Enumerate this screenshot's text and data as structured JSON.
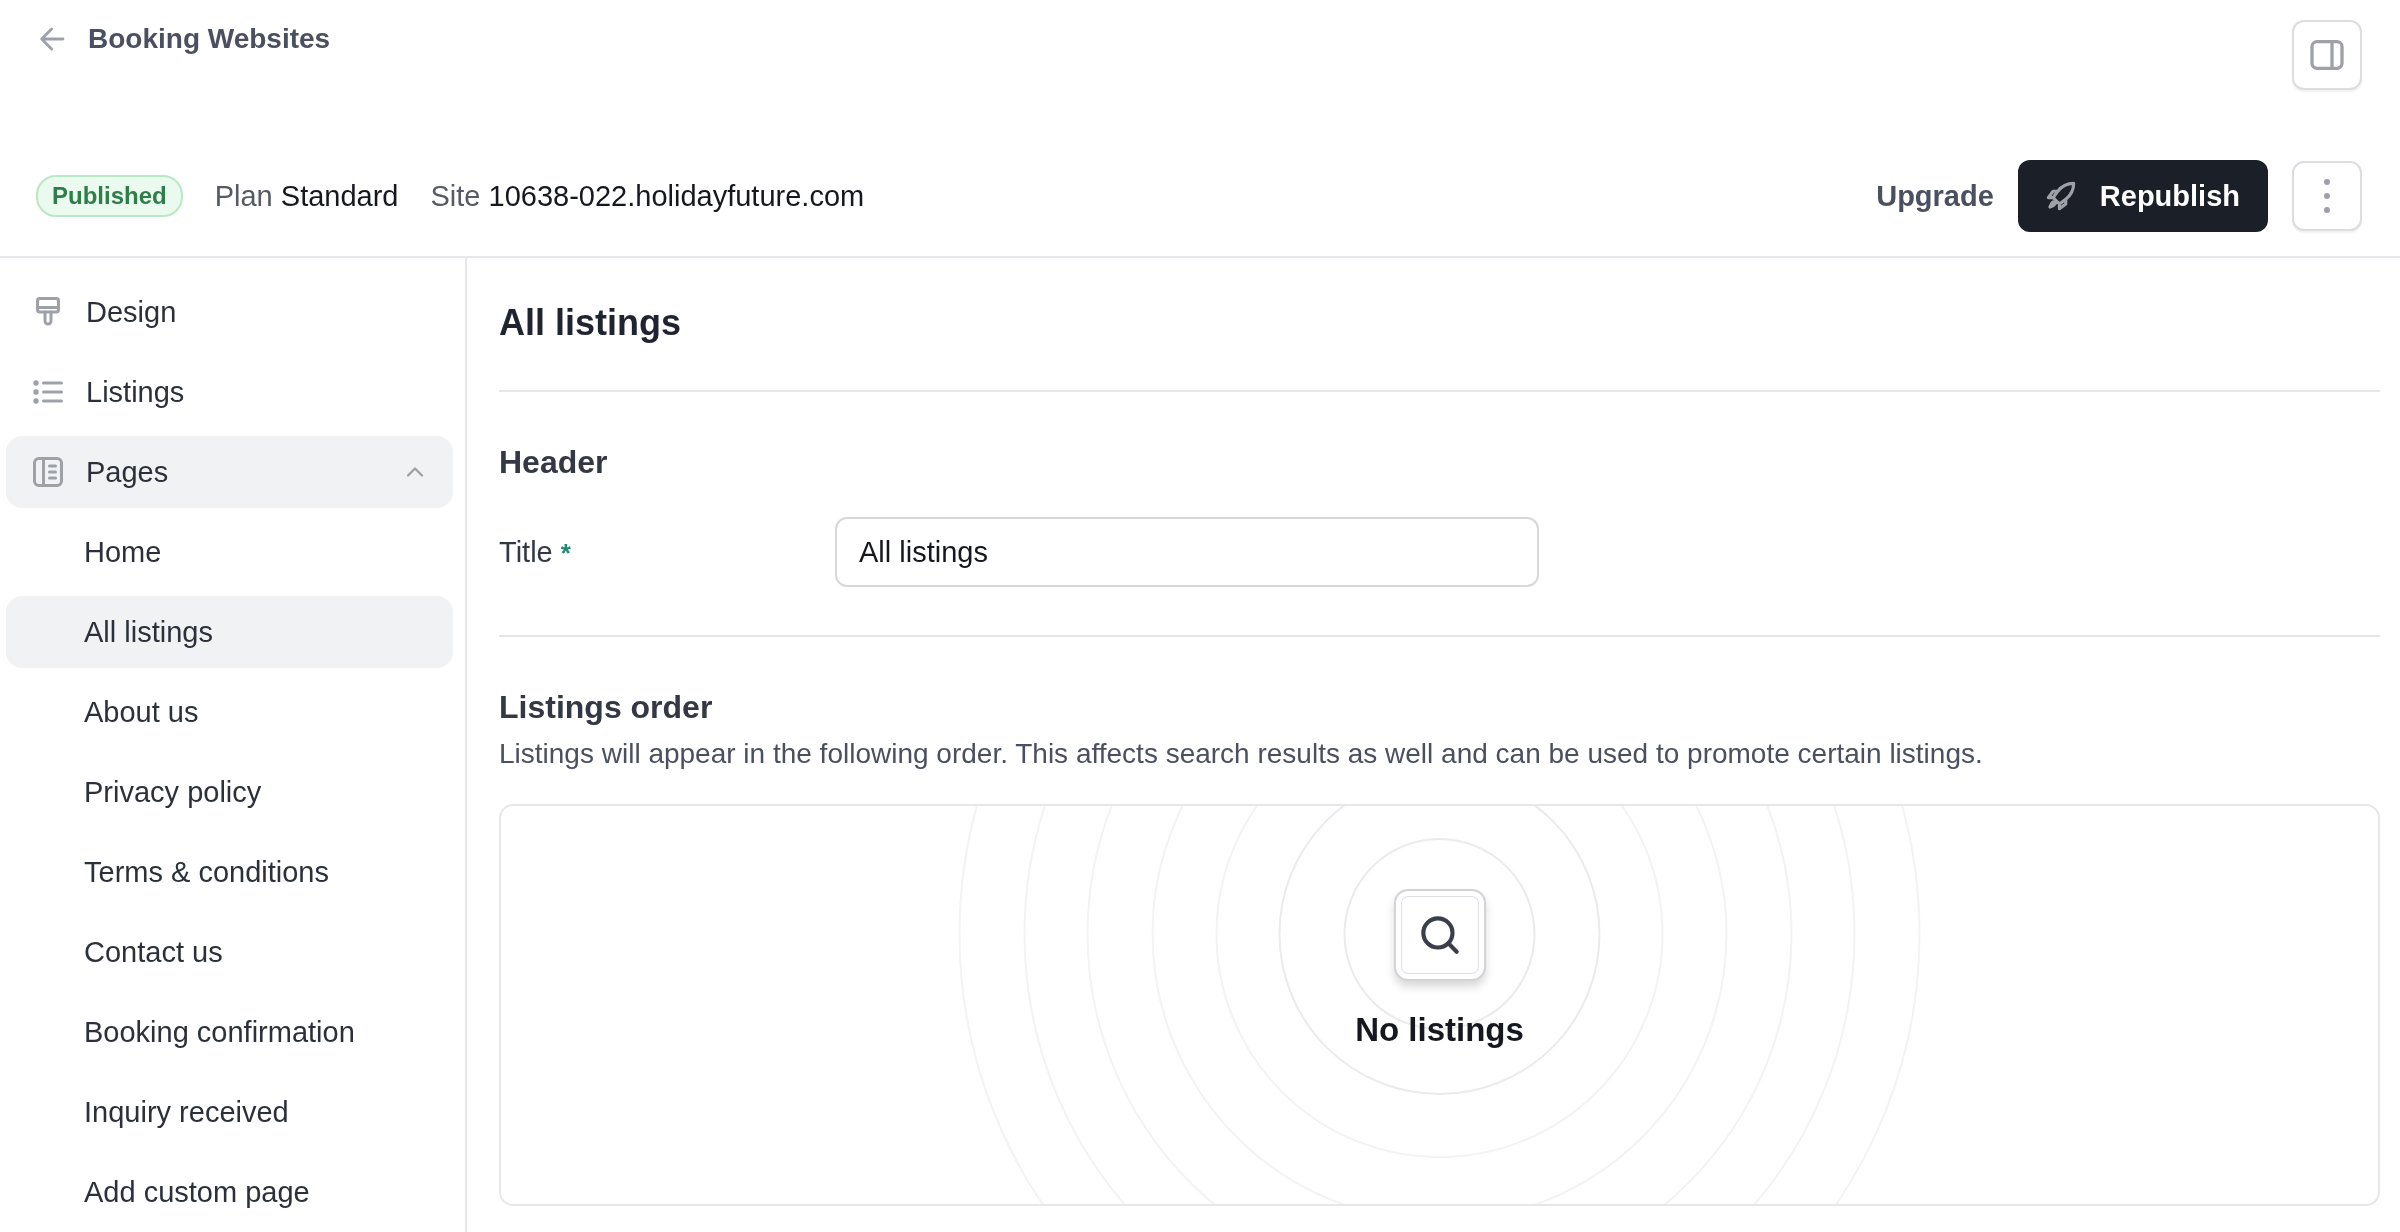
{
  "header": {
    "back_label": "Booking Websites",
    "status": "Published",
    "plan_label": "Plan",
    "plan": "Standard",
    "site_label": "Site",
    "site": "10638-022.holidayfuture.com",
    "upgrade": "Upgrade",
    "republish": "Republish"
  },
  "sidebar": {
    "items": [
      {
        "label": "Design",
        "selected": false
      },
      {
        "label": "Listings",
        "selected": false
      },
      {
        "label": "Pages",
        "selected": true,
        "expanded": true,
        "children": [
          {
            "label": "Home",
            "selected": false
          },
          {
            "label": "All listings",
            "selected": true
          },
          {
            "label": "About us",
            "selected": false
          },
          {
            "label": "Privacy policy",
            "selected": false
          },
          {
            "label": "Terms & conditions",
            "selected": false
          },
          {
            "label": "Contact us",
            "selected": false
          },
          {
            "label": "Booking confirmation",
            "selected": false
          },
          {
            "label": "Inquiry received",
            "selected": false
          },
          {
            "label": "Add custom page",
            "selected": false
          }
        ]
      }
    ]
  },
  "content": {
    "title": "All listings",
    "sections": [
      {
        "heading": "Header",
        "fields": [
          {
            "label": "Title",
            "required_mark": "*",
            "value": "All listings"
          }
        ]
      },
      {
        "heading": "Listings order",
        "description": "Listings will appear in the following order. This affects search results as well and can be used to promote certain listings.",
        "empty_state": {
          "message": "No listings"
        }
      }
    ]
  }
}
